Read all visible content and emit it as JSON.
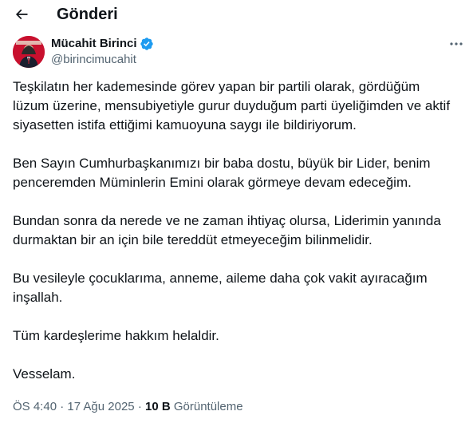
{
  "header": {
    "back_icon": "arrow-left-icon",
    "title": "Gönderi"
  },
  "author": {
    "display_name": "Mücahit Birinci",
    "handle": "@birincimucahit",
    "verified": true,
    "verified_color": "#1d9bf0"
  },
  "tweet": {
    "paragraphs": [
      [
        "Teşkilatın her kademesinde görev yapan bir partili olarak, gördüğüm",
        "lüzum üzerine, mensubiyetiyle gurur duyduğum parti üyeliğimden ve aktif",
        "siyasetten istifa ettiğimi kamuoyuna saygı ile bildiriyorum."
      ],
      [
        "Ben Sayın Cumhurbaşkanımızı bir baba dostu, büyük bir Lider, benim",
        "penceremden Müminlerin Emini olarak görmeye devam edeceğim."
      ],
      [
        "Bundan sonra da nerede ve ne zaman ihtiyaç olursa, Liderimin yanında",
        "durmaktan bir an için bile tereddüt etmeyeceğim bilinmelidir."
      ],
      [
        "Bu vesileyle çocuklarıma, anneme, aileme daha çok vakit ayıracağım",
        "inşallah."
      ],
      [
        "Tüm kardeşlerime hakkım helaldir."
      ],
      [
        "Vesselam."
      ]
    ]
  },
  "meta": {
    "time": "ÖS 4:40",
    "separator": "·",
    "date": "17 Ağu 2025",
    "views_count": "10 B",
    "views_label": "Görüntüleme"
  },
  "colors": {
    "text": "#0f1419",
    "secondary": "#536471",
    "avatar_bg": "#c8102e"
  }
}
